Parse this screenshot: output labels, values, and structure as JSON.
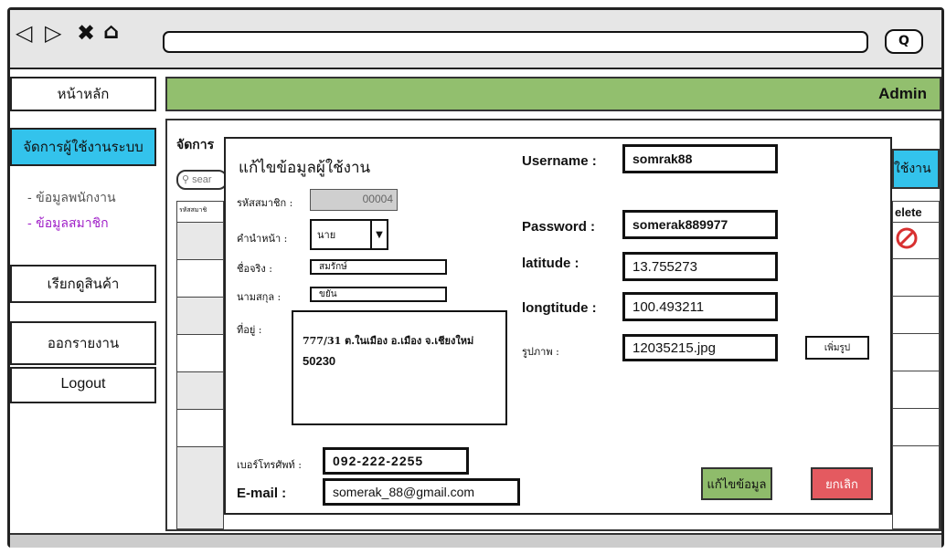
{
  "browser": {
    "nav_icons": {
      "back": "◁",
      "forward": "▷",
      "close": "✖",
      "home": "⌂"
    },
    "search_glyph": "Q"
  },
  "header": {
    "admin_label": "Admin"
  },
  "sidebar": {
    "home": "หน้าหลัก",
    "manage_users": "จัดการผู้ใช้งานระบบ",
    "sub_employee": "- ข้อมูลพนักงาน",
    "sub_member": "- ข้อมูลสมาชิก",
    "products": "เรียกดูสินค้า",
    "report": "ออกรายงาน",
    "logout": "Logout"
  },
  "background_page": {
    "title_fragment": "จัดการ",
    "search_fragment": "sear",
    "add_user_fragment": "ใช้งาน",
    "column_fragment": "รหัสสมาชิ",
    "delete_fragment": "elete"
  },
  "modal": {
    "title": "แก้ไขข้อมูลผู้ใช้งาน",
    "member_id_label": "รหัสสมาชิก :",
    "member_id_value": "00004",
    "prefix_label": "คำนำหน้า :",
    "prefix_value": "นาย",
    "firstname_label": "ชื่อจริง :",
    "firstname_value": "สมรักษ์",
    "lastname_label": "นามสกุล :",
    "lastname_value": "ขยัน",
    "address_label": "ที่อยู่ :",
    "address_line1": "777/31 ต.ในเมือง อ.เมือง จ.เชียงใหม่",
    "address_line2": "50230",
    "phone_label": "เบอร์โทรศัพท์ :",
    "phone_value": "092-222-2255",
    "email_label": "E-mail :",
    "email_value": "somerak_88@gmail.com",
    "username_label": "Username :",
    "username_value": "somrak88",
    "password_label": "Password :",
    "password_value": "somerak889977",
    "latitude_label": "latitude :",
    "latitude_value": "13.755273",
    "longitude_label": "longtitude :",
    "longitude_value": "100.493211",
    "photo_label": "รูปภาพ :",
    "photo_value": "12035215.jpg",
    "add_photo_button": "เพิ่มรูป",
    "save_button": "แก้ไขข้อมูล",
    "cancel_button": "ยกเลิก"
  },
  "colors": {
    "header_green": "#92bf6e",
    "sidebar_active": "#33c3ec",
    "save_green": "#8fbc6b",
    "cancel_red": "#e45a60",
    "delete_red": "#d83030"
  }
}
